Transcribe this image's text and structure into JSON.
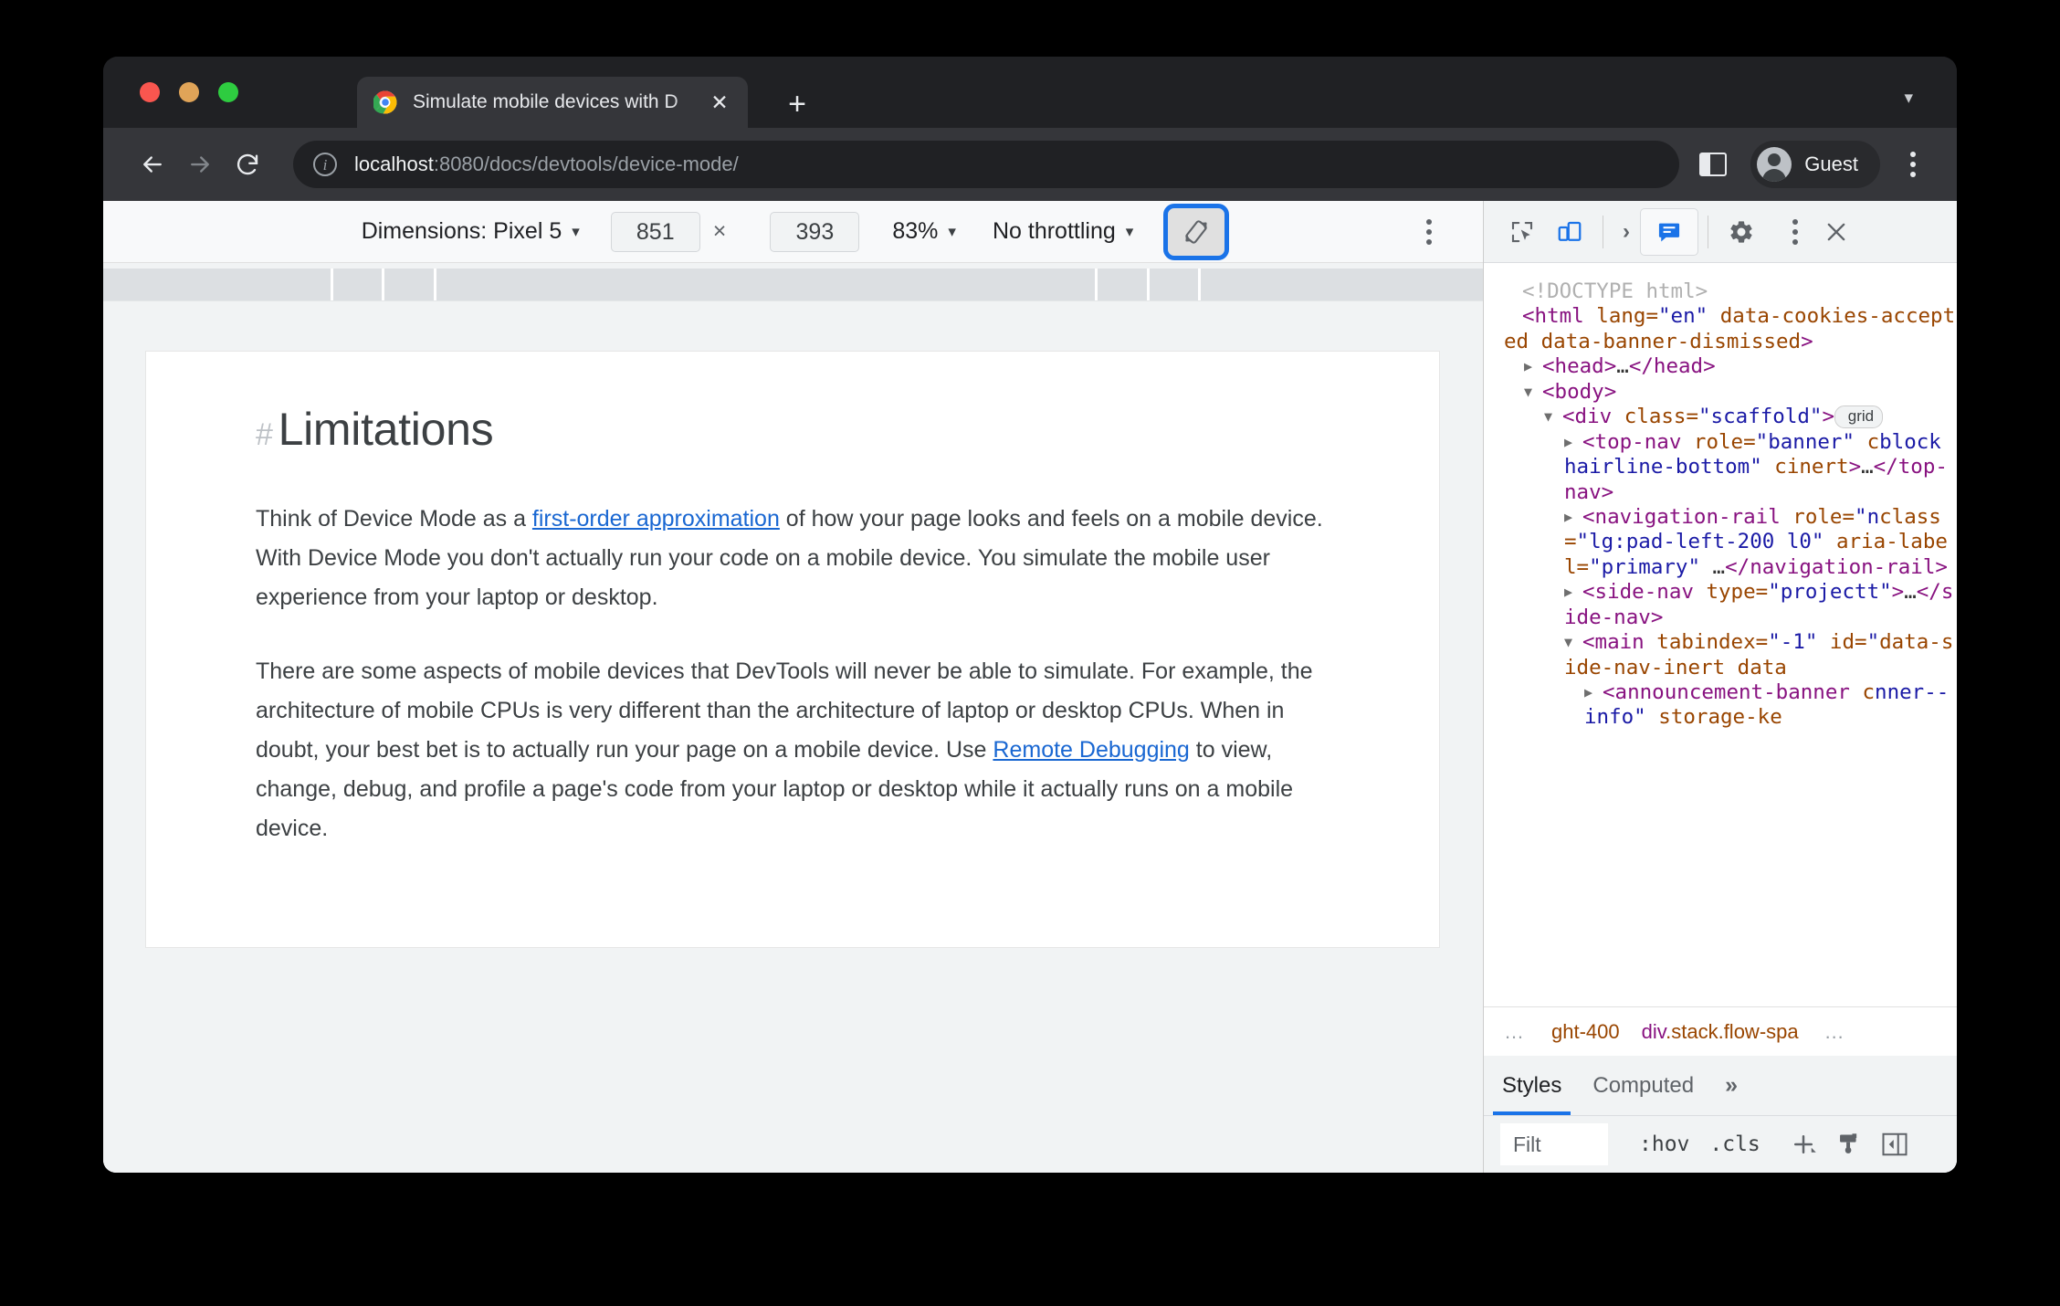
{
  "window": {
    "tab": {
      "title": "Simulate mobile devices with D",
      "favicon": "chrome-logo-icon",
      "close": "✕"
    },
    "new_tab": "+",
    "tabstrip_caret": "▾"
  },
  "omnibox": {
    "back": "back-arrow-icon",
    "forward": "forward-arrow-icon",
    "reload": "reload-icon",
    "security_icon": "i",
    "url_host": "localhost",
    "url_path": ":8080/docs/devtools/device-mode/",
    "side_panel": "side-panel-icon",
    "profile_label": "Guest",
    "menu": "kebab-menu-icon"
  },
  "device_toolbar": {
    "dimensions_label": "Dimensions: Pixel 5",
    "caret": "▾",
    "width": "851",
    "height": "393",
    "times": "×",
    "zoom": "83%",
    "throttling": "No throttling",
    "rotate_icon": "rotate-device-icon",
    "more": "kebab-menu-icon",
    "focus_ring_color": "#1a73e8"
  },
  "page": {
    "hash": "#",
    "heading": "Limitations",
    "paragraph1": {
      "before": "Think of Device Mode as a ",
      "link": "first-order approximation",
      "after": " of how your page looks and feels on a mobile device. With Device Mode you don't actually run your code on a mobile device. You simulate the mobile user experience from your laptop or desktop."
    },
    "paragraph2": {
      "before": "There are some aspects of mobile devices that DevTools will never be able to simulate. For example, the architecture of mobile CPUs is very different than the architecture of laptop or desktop CPUs. When in doubt, your best bet is to actually run your page on a mobile device. Use ",
      "link": "Remote Debugging",
      "after": " to view, change, debug, and profile a page's code from your laptop or desktop while it actually runs on a mobile device."
    },
    "link_color": "#1967d2"
  },
  "devtools": {
    "toolbar": {
      "inspect": "inspect-element-icon",
      "device_toggle": "device-toolbar-icon",
      "chevron": "›",
      "console": "console-message-icon",
      "settings": "gear-icon",
      "more": "kebab-menu-icon",
      "close": "✕",
      "active_color": "#1a73e8"
    },
    "dom": [
      {
        "indent": 0,
        "arrow": "",
        "parts": [
          {
            "t": "doctype",
            "v": "<!DOCTYPE html>"
          }
        ]
      },
      {
        "indent": 0,
        "arrow": "",
        "parts": [
          {
            "t": "tag",
            "v": "<html "
          },
          {
            "t": "attr",
            "v": "lang="
          },
          {
            "t": "val",
            "v": "\"en\""
          },
          {
            "t": "attr",
            "v": " data-cookies-accepted data-banner-dismissed"
          },
          {
            "t": "tag",
            "v": ">"
          }
        ]
      },
      {
        "indent": 1,
        "arrow": "▶",
        "parts": [
          {
            "t": "tag",
            "v": "<head>"
          },
          {
            "t": "text",
            "v": "…"
          },
          {
            "t": "tag",
            "v": "</head>"
          }
        ]
      },
      {
        "indent": 1,
        "arrow": "▼",
        "parts": [
          {
            "t": "tag",
            "v": "<body>"
          }
        ]
      },
      {
        "indent": 2,
        "arrow": "▼",
        "parts": [
          {
            "t": "tag",
            "v": "<div "
          },
          {
            "t": "attr",
            "v": "class="
          },
          {
            "t": "val",
            "v": "\"scaffold\""
          },
          {
            "t": "tag",
            "v": ">"
          },
          {
            "t": "badge",
            "v": "grid"
          }
        ]
      },
      {
        "indent": 3,
        "arrow": "▶",
        "parts": [
          {
            "t": "tag",
            "v": "<top-nav "
          },
          {
            "t": "attr",
            "v": "role="
          },
          {
            "t": "val",
            "v": "\"banner\""
          },
          {
            "t": "attr",
            "v": " c"
          },
          {
            "t": "val",
            "v": "block hairline-bottom\""
          },
          {
            "t": "attr",
            "v": " c"
          },
          {
            "t": "attr",
            "v": "inert"
          },
          {
            "t": "tag",
            "v": ">"
          },
          {
            "t": "text",
            "v": "…"
          },
          {
            "t": "tag",
            "v": "</top-nav>"
          }
        ]
      },
      {
        "indent": 3,
        "arrow": "▶",
        "parts": [
          {
            "t": "tag",
            "v": "<navigation-rail "
          },
          {
            "t": "attr",
            "v": "role="
          },
          {
            "t": "val",
            "v": "\"n"
          },
          {
            "t": "attr",
            "v": "class="
          },
          {
            "t": "val",
            "v": "\"lg:pad-left-200 l"
          },
          {
            "t": "val",
            "v": "0\""
          },
          {
            "t": "attr",
            "v": " aria-label="
          },
          {
            "t": "val",
            "v": "\"primary\""
          },
          {
            "t": "text",
            "v": " …"
          },
          {
            "t": "tag",
            "v": "</navigation-rail>"
          }
        ]
      },
      {
        "indent": 3,
        "arrow": "▶",
        "parts": [
          {
            "t": "tag",
            "v": "<side-nav "
          },
          {
            "t": "attr",
            "v": "type="
          },
          {
            "t": "val",
            "v": "\"project"
          },
          {
            "t": "val",
            "v": "t\""
          },
          {
            "t": "tag",
            "v": ">"
          },
          {
            "t": "text",
            "v": "…"
          },
          {
            "t": "tag",
            "v": "</side-nav>"
          }
        ]
      },
      {
        "indent": 3,
        "arrow": "▼",
        "parts": [
          {
            "t": "tag",
            "v": "<main "
          },
          {
            "t": "attr",
            "v": "tabindex="
          },
          {
            "t": "val",
            "v": "\"-1\""
          },
          {
            "t": "attr",
            "v": " id="
          },
          {
            "t": "val",
            "v": "\""
          },
          {
            "t": "attr",
            "v": "data-side-nav-inert data"
          }
        ]
      },
      {
        "indent": 4,
        "arrow": "▶",
        "parts": [
          {
            "t": "tag",
            "v": "<announcement-banner "
          },
          {
            "t": "attr",
            "v": "c"
          },
          {
            "t": "val",
            "v": "nner--info\""
          },
          {
            "t": "attr",
            "v": " storage-ke"
          }
        ]
      }
    ],
    "breadcrumb": {
      "left_ellipsis": "…",
      "items": [
        "ght-400",
        "div.stack.flow-spa"
      ],
      "right_ellipsis": "…"
    },
    "styles_tabs": {
      "tabs": [
        "Styles",
        "Computed"
      ],
      "active": "Styles",
      "more": "»"
    },
    "styles_filter": {
      "filter_placeholder": "Filt",
      "hov": ":hov",
      "cls": ".cls",
      "new_rule": "plus-icon",
      "color_picker": "paintbrush-icon",
      "toggle_sidebar": "toggle-sidebar-icon"
    }
  }
}
